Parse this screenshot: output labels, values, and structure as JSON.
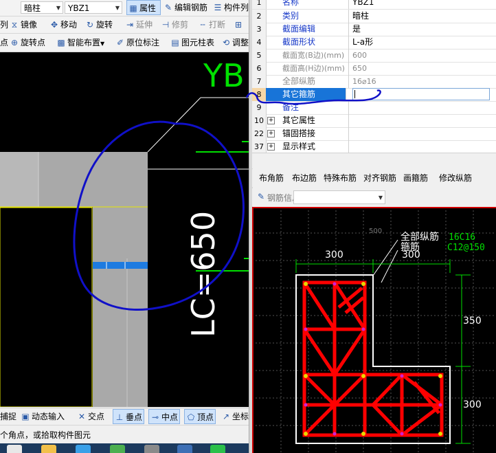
{
  "toolbar_top": {
    "layer_combo": "暗柱",
    "element_combo": "YBZ1",
    "properties_btn": "属性",
    "edit_rebar_btn": "编辑钢筋",
    "component_list_btn": "构件列"
  },
  "toolbar_edit": {
    "items": [
      "列",
      "镜像",
      "移动",
      "旋转",
      "延伸",
      "修剪",
      "打断",
      "合并"
    ]
  },
  "toolbar_draw": {
    "items": [
      "点",
      "旋转点",
      "智能布置",
      "原位标注",
      "图元柱表",
      "调整"
    ]
  },
  "canvas": {
    "title_text": "YB",
    "dimension_text": "LC=650"
  },
  "property_grid": {
    "rows": [
      {
        "num": "1",
        "name": "名称",
        "value": "YBZ1",
        "name_style": "blue"
      },
      {
        "num": "2",
        "name": "类别",
        "value": "暗柱",
        "name_style": "blue"
      },
      {
        "num": "3",
        "name": "截面编辑",
        "value": "是",
        "name_style": "blue"
      },
      {
        "num": "4",
        "name": "截面形状",
        "value": "L-a形",
        "name_style": "blue"
      },
      {
        "num": "5",
        "name": "截面宽(B边)(mm)",
        "value": "600",
        "name_style": "gray"
      },
      {
        "num": "6",
        "name": "截面高(H边)(mm)",
        "value": "650",
        "name_style": "gray"
      },
      {
        "num": "7",
        "name": "全部纵筋",
        "value": "16⌀16",
        "name_style": "gray"
      },
      {
        "num": "8",
        "name": "其它箍筋",
        "value": "",
        "name_style": "selected"
      },
      {
        "num": "9",
        "name": "备注",
        "value": "",
        "name_style": "blue"
      },
      {
        "num": "10",
        "name": "其它属性",
        "value": "",
        "name_style": "expand"
      },
      {
        "num": "22",
        "name": "锚固搭接",
        "value": "",
        "name_style": "expand"
      },
      {
        "num": "37",
        "name": "显示样式",
        "value": "",
        "name_style": "expand"
      }
    ]
  },
  "rebar_toolbar": {
    "items": [
      "布角筋",
      "布边筋",
      "特殊布筋",
      "对齐钢筋",
      "画箍筋",
      "修改纵筋"
    ],
    "info_label": "钢筋信息",
    "info_value": ""
  },
  "section_view": {
    "label_all_rebar": "全部纵筋",
    "label_all_rebar_value": "16C16",
    "label_stirrup": "箍筋",
    "label_stirrup_value": "C12@150",
    "dim_top_left": "300",
    "dim_top_right": "300",
    "dim_right_top": "350",
    "dim_right_bottom": "300",
    "grid_label": "500"
  },
  "snap_bar": {
    "items": [
      "捕捉",
      "动态输入",
      "交点",
      "垂点",
      "中点",
      "顶点",
      "坐标"
    ]
  },
  "status_bar": {
    "text": "个角点，或拾取构件图元"
  },
  "colors": {
    "canvas_bg": "#000000",
    "rebar_red": "#ff0000",
    "dim_green": "#00e000",
    "annotation_blue": "#1010c8",
    "selected_row": "#1874d8"
  }
}
